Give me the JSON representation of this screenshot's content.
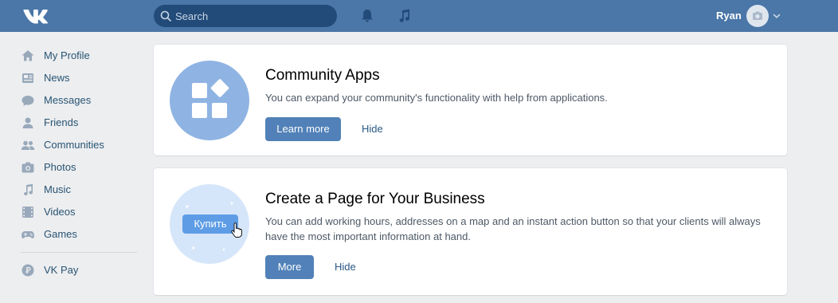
{
  "header": {
    "logo_icon": "vk-logo-icon",
    "search": {
      "placeholder": "Search"
    },
    "notifications_icon": "bell-icon",
    "music_icon": "music-note-icon",
    "user": {
      "name": "Ryan",
      "avatar_icon": "camera-icon",
      "menu_icon": "chevron-down-icon"
    },
    "colors": {
      "bar": "#4a76a8",
      "search_bg": "#224b7a"
    }
  },
  "sidebar": {
    "items": [
      {
        "label": "My Profile",
        "icon": "home-icon"
      },
      {
        "label": "News",
        "icon": "news-icon"
      },
      {
        "label": "Messages",
        "icon": "chat-bubble-icon"
      },
      {
        "label": "Friends",
        "icon": "person-icon"
      },
      {
        "label": "Communities",
        "icon": "people-icon"
      },
      {
        "label": "Photos",
        "icon": "camera-icon"
      },
      {
        "label": "Music",
        "icon": "music-note-icon"
      },
      {
        "label": "Videos",
        "icon": "film-icon"
      },
      {
        "label": "Games",
        "icon": "gamepad-icon"
      }
    ],
    "secondary": [
      {
        "label": "VK Pay",
        "icon": "vk-pay-icon"
      }
    ]
  },
  "cards": [
    {
      "title": "Community Apps",
      "description": "You can expand your community's functionality with help from applications.",
      "primary_label": "Learn more",
      "secondary_label": "Hide",
      "illustration_icon": "apps-grid-icon"
    },
    {
      "title": "Create a Page for Your Business",
      "description": "You can add working hours, addresses on a map and an instant action button so that your clients will always have the most important information at hand.",
      "primary_label": "More",
      "secondary_label": "Hide",
      "illustration_icon": "buy-button-icon",
      "illustration_text": "Купить"
    }
  ]
}
